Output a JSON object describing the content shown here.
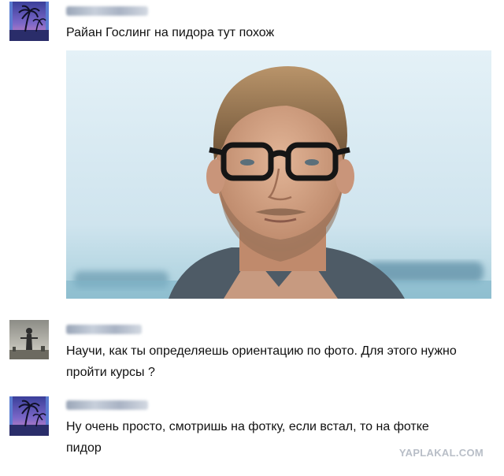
{
  "posts": [
    {
      "text": "Райан Гослинг на пидора тут похож"
    },
    {
      "text": "Научи, как ты определяешь ориентацию по фото. Для этого нужно пройти курсы ?"
    },
    {
      "text": "Ну очень просто, смотришь на фотку, если встал, то на фотке пидор"
    }
  ],
  "watermark": "YAPLAKAL.COM",
  "colors": {
    "text": "#111111",
    "sky": "#d6eaf2",
    "sea": "#9cc7d6",
    "watermark": "#b8bec7"
  },
  "icons": {
    "avatar_1": "palm-sunset-avatar",
    "avatar_2": "person-statue-avatar",
    "avatar_3": "palm-sunset-avatar"
  }
}
